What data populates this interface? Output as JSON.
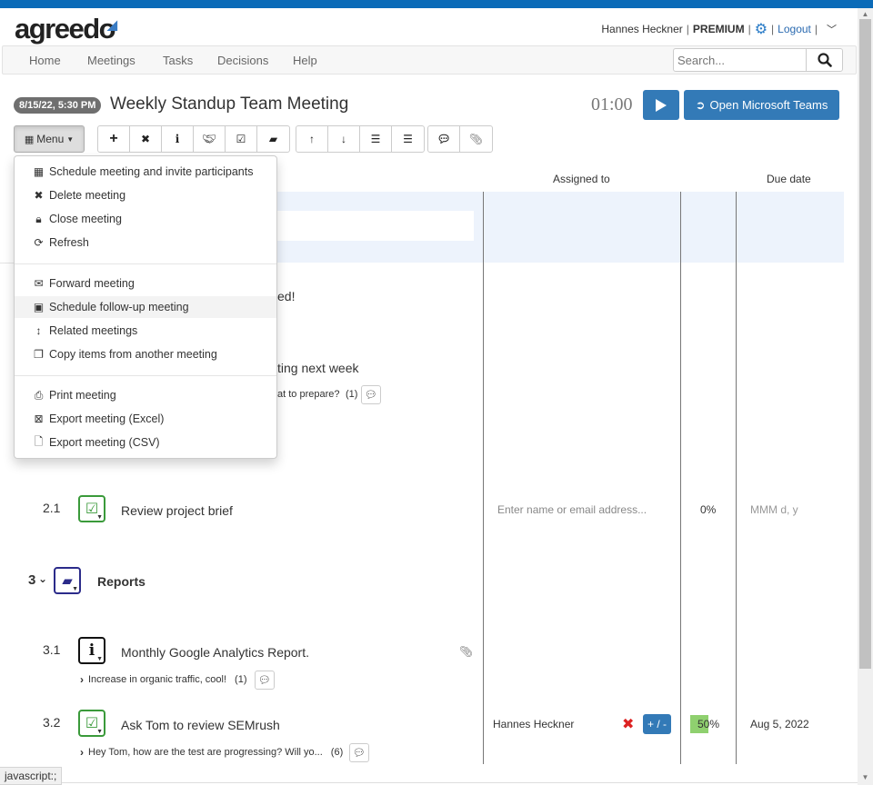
{
  "header": {
    "logo": "agreedo",
    "user_name": "Hannes Heckner",
    "plan": "PREMIUM",
    "logout": "Logout",
    "separator": "|"
  },
  "nav": {
    "items": [
      "Home",
      "Meetings",
      "Tasks",
      "Decisions",
      "Help"
    ],
    "search_placeholder": "Search..."
  },
  "meeting": {
    "date_badge": "8/15/22, 5:30 PM",
    "title": "Weekly Standup Team Meeting",
    "timer": "01:00",
    "open_teams_label": "Open Microsoft Teams"
  },
  "toolbar": {
    "menu_label": "Menu",
    "groups": [
      [
        "add-icon",
        "delete-icon",
        "info-icon",
        "handshake-icon",
        "task-icon",
        "folder-icon"
      ],
      [
        "arrow-up-icon",
        "arrow-down-icon",
        "indent-icon",
        "outdent-icon"
      ],
      [
        "comment-icon",
        "paperclip-icon"
      ]
    ]
  },
  "dropdown": {
    "sections": [
      [
        {
          "icon": "calendar-icon",
          "label": "Schedule meeting and invite participants"
        },
        {
          "icon": "close-icon",
          "label": "Delete meeting"
        },
        {
          "icon": "lock-icon",
          "label": "Close meeting"
        },
        {
          "icon": "refresh-icon",
          "label": "Refresh"
        }
      ],
      [
        {
          "icon": "envelope-icon",
          "label": "Forward meeting"
        },
        {
          "icon": "calendar-plus-icon",
          "label": "Schedule follow-up meeting"
        },
        {
          "icon": "vertical-arrows-icon",
          "label": "Related meetings"
        },
        {
          "icon": "copy-icon",
          "label": "Copy items from another meeting"
        }
      ],
      [
        {
          "icon": "print-icon",
          "label": "Print meeting"
        },
        {
          "icon": "excel-file-icon",
          "label": "Export meeting (Excel)"
        },
        {
          "icon": "file-icon",
          "label": "Export meeting (CSV)"
        }
      ]
    ]
  },
  "table": {
    "headers": {
      "assigned_to": "Assigned to",
      "due_date": "Due date"
    },
    "partial_texts": {
      "row_a": "ed!",
      "row_b": "ting next week",
      "row_b_sub": "at to prepare?",
      "row_b_count": "(1)"
    },
    "items": [
      {
        "number": "2.1",
        "type": "task",
        "title": "Review project brief",
        "assignee_placeholder": "Enter name or email address...",
        "progress": "0%",
        "due_placeholder": "MMM d, y"
      },
      {
        "number": "3",
        "type": "folder",
        "title": "Reports"
      },
      {
        "number": "3.1",
        "type": "info",
        "title": "Monthly Google Analytics Report.",
        "comment": "Increase in organic traffic, cool!",
        "comment_count": "(1)"
      },
      {
        "number": "3.2",
        "type": "task",
        "title": "Ask Tom to review SEMrush",
        "comment": "Hey Tom, how are the test are progressing? Will yo...",
        "comment_count": "(6)",
        "assignee": "Hannes Heckner",
        "assign_toggle": "+ / -",
        "progress": "50%",
        "progress_value": 50,
        "due": "Aug 5, 2022"
      }
    ]
  },
  "statusbar": "javascript:;",
  "colors": {
    "brand_blue": "#0b6bb8",
    "button_blue": "#337ab7",
    "task_green": "#3a9a3a",
    "folder_navy": "#2b2b8a",
    "progress_green": "#8fd06f"
  }
}
